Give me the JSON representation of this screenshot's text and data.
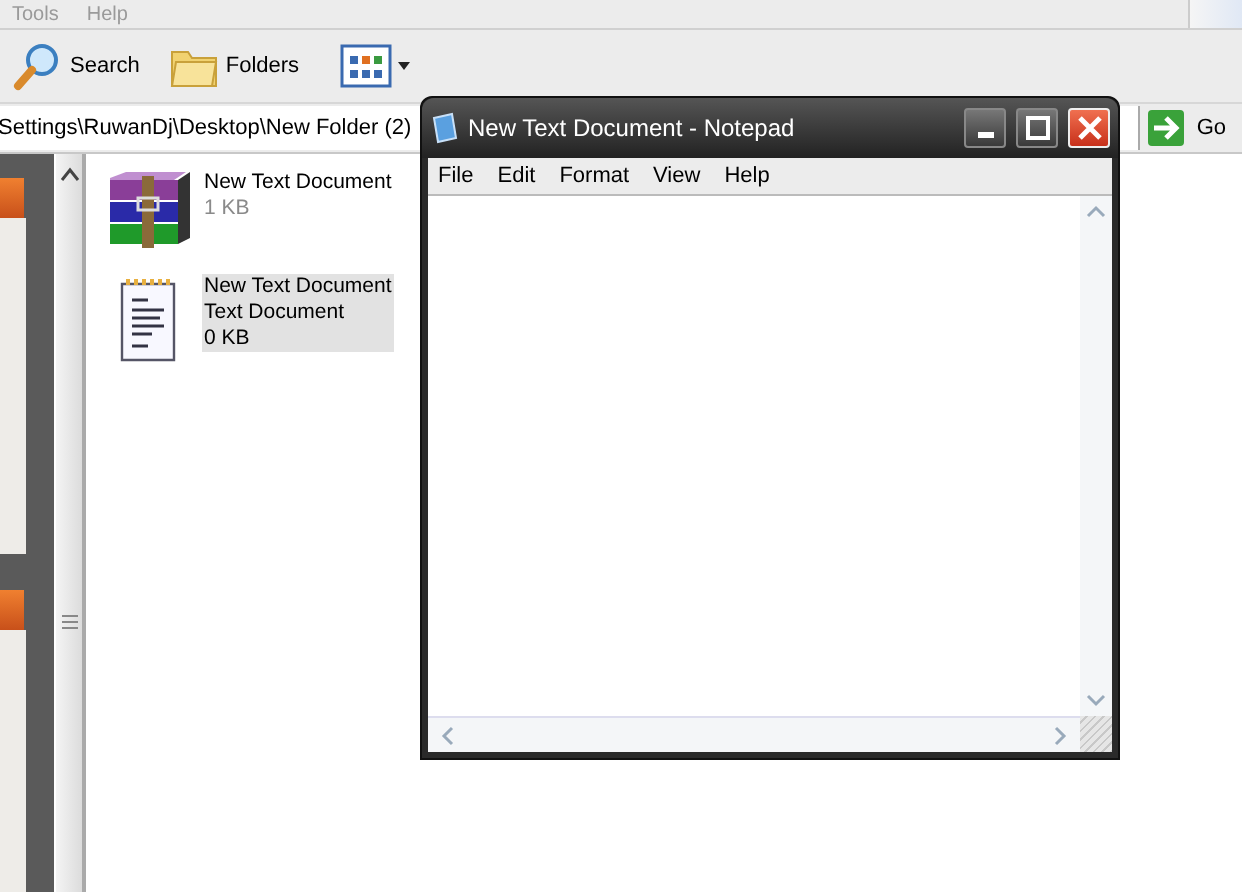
{
  "menu_bar": {
    "items": [
      "Tools",
      "Help"
    ]
  },
  "toolbar": {
    "buttons": [
      {
        "kind": "search",
        "label": "Search"
      },
      {
        "kind": "folders",
        "label": "Folders"
      },
      {
        "kind": "views"
      }
    ]
  },
  "address_bar": {
    "path": "Settings\\RuwanDj\\Desktop\\New Folder (2)",
    "go_label": "Go"
  },
  "files": [
    {
      "kind": "archive",
      "name": "New Text Document",
      "details": [
        "1 KB"
      ],
      "selected": false
    },
    {
      "kind": "text",
      "name": "New Text Document",
      "details": [
        "Text Document",
        "0 KB"
      ],
      "selected": true
    }
  ],
  "notepad": {
    "title": "New Text Document - Notepad",
    "menu": [
      "File",
      "Edit",
      "Format",
      "View",
      "Help"
    ]
  }
}
